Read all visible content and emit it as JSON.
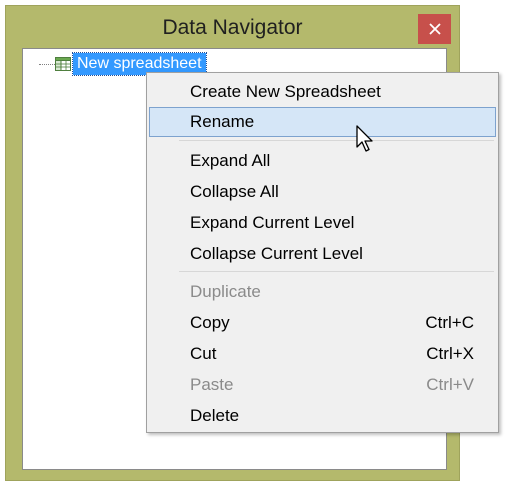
{
  "window": {
    "title": "Data Navigator",
    "close_icon": "close-icon",
    "frame_color": "#b4b96c",
    "close_color": "#c7504b"
  },
  "tree": {
    "node_icon": "spreadsheet-icon",
    "selected_node_label": "New spreadsheet",
    "selection_color": "#3399ff"
  },
  "context_menu": {
    "highlight_color": "#d5e6f7",
    "items": [
      {
        "label": "Create New Spreadsheet",
        "shortcut": "",
        "enabled": true
      },
      {
        "label": "Rename",
        "shortcut": "",
        "enabled": true,
        "highlighted": true
      },
      {
        "label": "Expand All",
        "shortcut": "",
        "enabled": true
      },
      {
        "label": "Collapse All",
        "shortcut": "",
        "enabled": true
      },
      {
        "label": "Expand Current Level",
        "shortcut": "",
        "enabled": true
      },
      {
        "label": "Collapse Current Level",
        "shortcut": "",
        "enabled": true
      },
      {
        "label": "Duplicate",
        "shortcut": "",
        "enabled": false
      },
      {
        "label": "Copy",
        "shortcut": "Ctrl+C",
        "enabled": true
      },
      {
        "label": "Cut",
        "shortcut": "Ctrl+X",
        "enabled": true
      },
      {
        "label": "Paste",
        "shortcut": "Ctrl+V",
        "enabled": false
      },
      {
        "label": "Delete",
        "shortcut": "",
        "enabled": true
      }
    ]
  },
  "cursor": {
    "icon": "mouse-pointer-icon"
  }
}
